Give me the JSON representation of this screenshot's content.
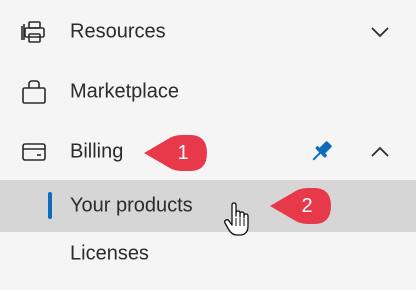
{
  "nav": {
    "items": [
      {
        "label": "Resources",
        "icon": "printer-stack-icon",
        "chevron": "chevron-down-icon"
      },
      {
        "label": "Marketplace",
        "icon": "shopping-bag-icon"
      },
      {
        "label": "Billing",
        "icon": "credit-card-icon",
        "chevron": "chevron-up-icon",
        "pinned": true
      }
    ],
    "sub_items": [
      {
        "label": "Your products",
        "selected": true
      },
      {
        "label": "Licenses",
        "selected": false
      }
    ]
  },
  "callouts": [
    {
      "number": "1"
    },
    {
      "number": "2"
    }
  ],
  "colors": {
    "accent": "#0f6cbd",
    "callout": "#e8394a",
    "selected_bg": "#d6d6d6",
    "background": "#f5f5f5"
  }
}
